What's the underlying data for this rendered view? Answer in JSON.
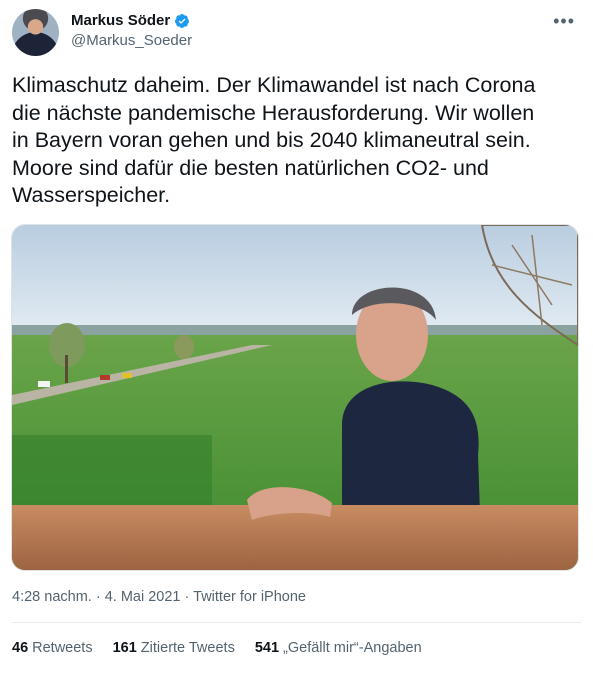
{
  "author": {
    "display_name": "Markus Söder",
    "handle": "@Markus_Soeder",
    "verified_color": "#1d9bf0"
  },
  "tweet": {
    "text": "Klimaschutz daheim. Der Klimawandel ist nach Corona\ndie nächste pandemische Herausforderung. Wir wollen\nin Bayern voran gehen und bis 2040 klimaneutral sein.\nMoore sind dafür die besten natürlichen CO2- und\nWasserspeicher."
  },
  "meta": {
    "time": "4:28 nachm.",
    "date": "4. Mai 2021",
    "source": "Twitter for iPhone",
    "separator": "·"
  },
  "stats": {
    "retweets_count": "46",
    "retweets_label": "Retweets",
    "quotes_count": "161",
    "quotes_label": "Zitierte Tweets",
    "likes_count": "541",
    "likes_label": "„Gefällt mir“-Angaben"
  },
  "icons": {
    "more": "more-icon",
    "verified": "verified-badge-icon"
  }
}
